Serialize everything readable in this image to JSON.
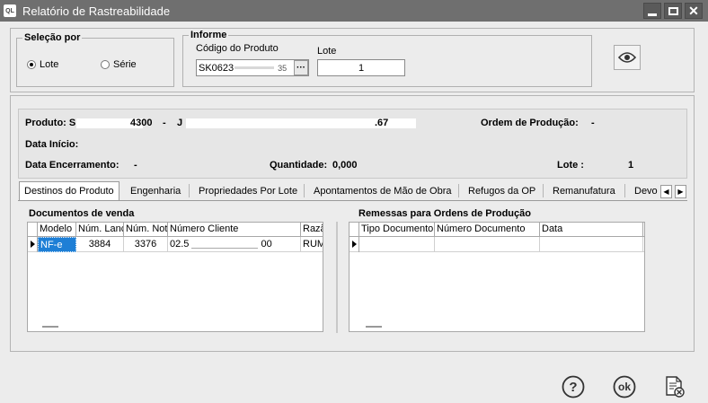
{
  "window": {
    "title": "Relatório de Rastreabilidade",
    "app_icon_text": "QL"
  },
  "selecao": {
    "title": "Seleção por",
    "options": [
      {
        "label": "Lote",
        "selected": true
      },
      {
        "label": "Série",
        "selected": false
      }
    ]
  },
  "informe": {
    "title": "Informe",
    "codigo_label": "Código do Produto",
    "codigo_value": "SK0623",
    "codigo_suffix": "35",
    "ellipsis": "···",
    "lote_label": "Lote",
    "lote_value": "1"
  },
  "info": {
    "produto_label": "Produto: S",
    "produto_code_tail": "4300",
    "produto_sep": "-",
    "produto_desc_start": "J",
    "produto_desc_fragment": ".67",
    "ordem_label": "Ordem de Produção:",
    "ordem_value": "-",
    "data_inicio_label": "Data Início:",
    "data_encerramento_label": "Data Encerramento:",
    "data_encerramento_value": "-",
    "quantidade_label": "Quantidade:",
    "quantidade_value": "0,000",
    "lote_label": "Lote :",
    "lote_value": "1"
  },
  "tabs": [
    {
      "label": "Destinos do Produto",
      "active": true
    },
    {
      "label": "Engenharia",
      "active": false
    },
    {
      "label": "Propriedades Por Lote",
      "active": false
    },
    {
      "label": "Apontamentos de Mão de Obra",
      "active": false
    },
    {
      "label": "Refugos da OP",
      "active": false
    },
    {
      "label": "Remanufatura",
      "active": false
    },
    {
      "label": "Devo",
      "active": false
    }
  ],
  "docs_venda": {
    "title": "Documentos de venda",
    "columns": [
      "Modelo",
      "Núm. Lanç",
      "Núm. Not",
      "Número Cliente",
      "Razã"
    ],
    "rows": [
      {
        "modelo": "NF-e",
        "num_lanc": "3884",
        "num_nota": "3376",
        "num_cliente": "02.5",
        "num_cliente_tail": "00",
        "razao": "RUM"
      }
    ]
  },
  "remessas": {
    "title": "Remessas para Ordens de Produção",
    "columns": [
      "Tipo Documento",
      "Número Documento",
      "Data"
    ]
  },
  "colors": {
    "titlebar": "#6f6f6f",
    "selected_cell": "#1e7fd6"
  },
  "footer": {
    "help_icon_text": "?",
    "ok_icon_text": "ok"
  }
}
